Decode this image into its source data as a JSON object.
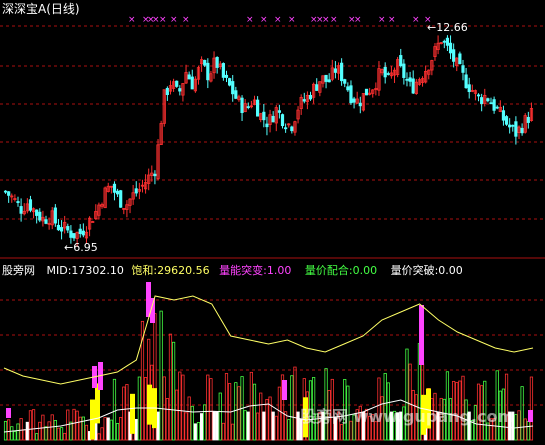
{
  "header": {
    "title": "深深宝A",
    "period": "(日线)"
  },
  "annotations": {
    "high": "12.66",
    "low": "6.95",
    "arrow": "←"
  },
  "lower_panel": {
    "panel_label": "股旁网",
    "mid_label": "MID:",
    "mid_value": "17302.10",
    "sat_label": "饱和:",
    "sat_value": "29620.56",
    "breakout_label": "量能突变:",
    "breakout_value": "1.00",
    "match_label": "量价配合:",
    "match_value": "0.00",
    "break2_label": "量价突破:",
    "break2_value": "0.00"
  },
  "watermark": "股旁网 www.gupang.com",
  "colors": {
    "background": "#000000",
    "up_candle": "#ff3030",
    "down_candle": "#54ffff",
    "grid": "#aa1010",
    "marker": "#ff44ff",
    "mid_line": "#ffffff",
    "sat_line": "#ffff66",
    "green_bar": "#44ff44",
    "yellow_bar": "#ffff00",
    "magenta_bar": "#ff44ff",
    "white_bar": "#ffffff",
    "text_white": "#ffffff",
    "text_yellow": "#ffff66",
    "text_magenta": "#ff44ff",
    "text_green": "#44ff44"
  },
  "chart_data": [
    {
      "type": "candlestick",
      "title": "深深宝A (日线)",
      "ylim": [
        6.5,
        13.2
      ],
      "price": [
        8.2,
        8.0,
        7.7,
        7.9,
        7.6,
        7.4,
        7.5,
        7.2,
        7.1,
        6.95,
        7.0,
        7.3,
        7.6,
        8.1,
        8.4,
        8.0,
        7.8,
        8.1,
        8.3,
        8.6,
        8.9,
        10.9,
        11.4,
        11.0,
        11.7,
        11.3,
        11.9,
        11.6,
        12.0,
        11.5,
        11.2,
        10.8,
        10.6,
        10.9,
        10.4,
        10.2,
        10.6,
        10.3,
        10.1,
        10.7,
        10.9,
        11.2,
        11.5,
        11.4,
        11.8,
        11.5,
        11.0,
        10.8,
        11.1,
        11.3,
        11.7,
        11.4,
        11.9,
        11.6,
        11.2,
        11.5,
        11.8,
        12.2,
        12.66,
        12.3,
        11.9,
        11.5,
        11.2,
        10.9,
        11.0,
        10.7,
        10.4,
        10.1,
        9.9,
        10.2,
        10.5
      ],
      "volume_mid": [
        0.2,
        0.25,
        0.3,
        0.35,
        0.45,
        0.55,
        0.75,
        0.8,
        0.8,
        0.75,
        0.7,
        0.72,
        0.7,
        0.85,
        0.9,
        0.6,
        0.5,
        0.55,
        0.6,
        0.7,
        0.9,
        1.0,
        0.8,
        0.7,
        0.6,
        0.4,
        0.35,
        0.3,
        0.35
      ],
      "volume_sat": [
        1.8,
        1.6,
        1.5,
        1.4,
        1.5,
        1.6,
        1.7,
        2.0,
        3.6,
        3.5,
        3.6,
        3.4,
        2.6,
        2.5,
        2.4,
        2.5,
        2.3,
        2.2,
        2.4,
        2.6,
        3.0,
        3.2,
        3.4,
        3.0,
        2.7,
        2.5,
        2.3,
        2.2,
        2.3
      ]
    }
  ]
}
